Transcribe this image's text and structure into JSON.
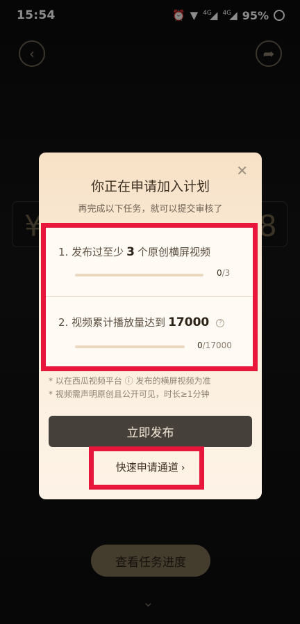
{
  "status_bar": {
    "time": "15:54",
    "alarm_icon": "alarm-icon",
    "wifi_icon": "wifi-icon",
    "signal_label_1": "4G",
    "signal_label_2": "4G",
    "battery": "95%"
  },
  "nav": {
    "back_icon": "back-arrow-icon",
    "share_icon": "share-icon"
  },
  "background": {
    "amount_prefix": "¥",
    "amount_suffix": "8",
    "progress_button": "查看任务进度"
  },
  "modal": {
    "title": "你正在申请加入计划",
    "subtitle": "再完成以下任务，就可以提交审核了",
    "tasks": [
      {
        "prefix": "1. 发布过至少",
        "target": "3",
        "suffix": "个原创横屏视频",
        "current": "0",
        "total": "/3",
        "progress": 0
      },
      {
        "prefix": "2. 视频累计播放量达到",
        "target": "17000",
        "suffix": "",
        "current": "0",
        "total": "/17000",
        "progress": 0
      }
    ],
    "notes": [
      "* 以在西瓜视频平台 ⓘ 发布的横屏视频为准",
      "* 视频需声明原创且公开可见，时长≥1分钟"
    ],
    "publish_button": "立即发布",
    "quick_apply_link": "快速申请通道"
  },
  "colors": {
    "annotation_red": "#e8163b",
    "modal_bg": "#fbeedd",
    "publish_button_bg": "#45403a"
  }
}
